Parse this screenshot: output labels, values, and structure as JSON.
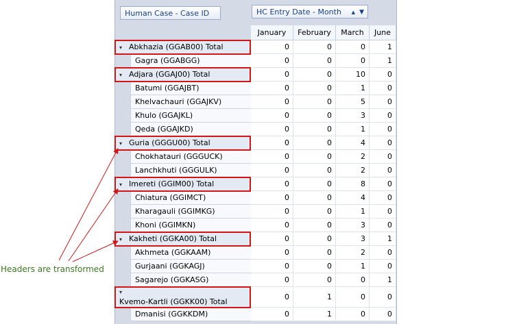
{
  "pivot": {
    "row_field": "Human Case - Case ID",
    "column_field": "HC Entry Date - Month",
    "months": [
      "January",
      "February",
      "March",
      "June"
    ],
    "rows": [
      {
        "label": "Abkhazia (GGAB00) Total",
        "total": true,
        "v": [
          "0",
          "0",
          "0",
          "1"
        ]
      },
      {
        "label": "Gagra (GGABGG)",
        "total": false,
        "v": [
          "0",
          "0",
          "0",
          "1"
        ]
      },
      {
        "label": "Adjara (GGAJ00) Total",
        "total": true,
        "v": [
          "0",
          "0",
          "10",
          "0"
        ]
      },
      {
        "label": "Batumi (GGAJBT)",
        "total": false,
        "v": [
          "0",
          "0",
          "1",
          "0"
        ]
      },
      {
        "label": "Khelvachauri (GGAJKV)",
        "total": false,
        "v": [
          "0",
          "0",
          "5",
          "0"
        ]
      },
      {
        "label": "Khulo (GGAJKL)",
        "total": false,
        "v": [
          "0",
          "0",
          "3",
          "0"
        ]
      },
      {
        "label": "Qeda (GGAJKD)",
        "total": false,
        "v": [
          "0",
          "0",
          "1",
          "0"
        ]
      },
      {
        "label": "Guria (GGGU00) Total",
        "total": true,
        "v": [
          "0",
          "0",
          "4",
          "0"
        ]
      },
      {
        "label": "Chokhatauri (GGGUCK)",
        "total": false,
        "v": [
          "0",
          "0",
          "2",
          "0"
        ]
      },
      {
        "label": "Lanchkhuti (GGGULK)",
        "total": false,
        "v": [
          "0",
          "0",
          "2",
          "0"
        ]
      },
      {
        "label": "Imereti (GGIM00) Total",
        "total": true,
        "v": [
          "0",
          "0",
          "8",
          "0"
        ]
      },
      {
        "label": "Chiatura (GGIMCT)",
        "total": false,
        "v": [
          "0",
          "0",
          "4",
          "0"
        ]
      },
      {
        "label": "Kharagauli (GGIMKG)",
        "total": false,
        "v": [
          "0",
          "0",
          "1",
          "0"
        ]
      },
      {
        "label": "Khoni (GGIMKN)",
        "total": false,
        "v": [
          "0",
          "0",
          "3",
          "0"
        ]
      },
      {
        "label": "Kakheti (GGKA00) Total",
        "total": true,
        "v": [
          "0",
          "0",
          "3",
          "1"
        ]
      },
      {
        "label": "Akhmeta (GGKAAM)",
        "total": false,
        "v": [
          "0",
          "0",
          "2",
          "0"
        ]
      },
      {
        "label": "Gurjaani (GGKAGJ)",
        "total": false,
        "v": [
          "0",
          "0",
          "1",
          "0"
        ]
      },
      {
        "label": "Sagarejo (GGKASG)",
        "total": false,
        "v": [
          "0",
          "0",
          "0",
          "1"
        ]
      },
      {
        "label": "Kvemo-Kartli (GGKK00) Total",
        "total": true,
        "tall": true,
        "v": [
          "0",
          "1",
          "0",
          "0"
        ]
      },
      {
        "label": "Dmanisi (GGKKDM)",
        "total": false,
        "v": [
          "0",
          "1",
          "0",
          "0"
        ]
      }
    ]
  },
  "annotation": {
    "text": "Headers are transformed",
    "highlight_color": "#d31515",
    "text_color": "#3b7a1f"
  }
}
